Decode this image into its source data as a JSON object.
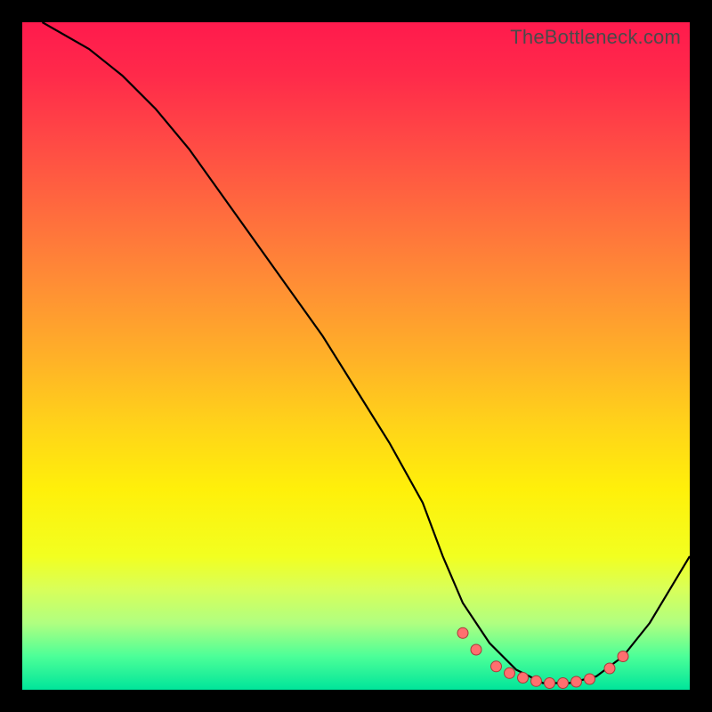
{
  "watermark": "TheBottleneck.com",
  "chart_data": {
    "type": "line",
    "title": "",
    "xlabel": "",
    "ylabel": "",
    "xlim": [
      0,
      100
    ],
    "ylim": [
      0,
      100
    ],
    "curve": {
      "x": [
        3,
        10,
        15,
        20,
        25,
        30,
        35,
        40,
        45,
        50,
        55,
        60,
        63,
        66,
        70,
        74,
        78,
        82,
        86,
        90,
        94,
        100
      ],
      "y": [
        100,
        96,
        92,
        87,
        81,
        74,
        67,
        60,
        53,
        45,
        37,
        28,
        20,
        13,
        7,
        3,
        1,
        1,
        2,
        5,
        10,
        20
      ]
    },
    "series": [
      {
        "name": "markers",
        "x": [
          66,
          68,
          71,
          73,
          75,
          77,
          79,
          81,
          83,
          85,
          88,
          90
        ],
        "y": [
          8.5,
          6.0,
          3.5,
          2.5,
          1.8,
          1.3,
          1.0,
          1.0,
          1.2,
          1.6,
          3.2,
          5.0
        ]
      }
    ],
    "colors": {
      "curve": "#000000",
      "marker_fill": "#ff6f6f",
      "marker_stroke": "#a83a3a",
      "gradient_top": "#ff1a4d",
      "gradient_bottom": "#00e59a"
    }
  }
}
